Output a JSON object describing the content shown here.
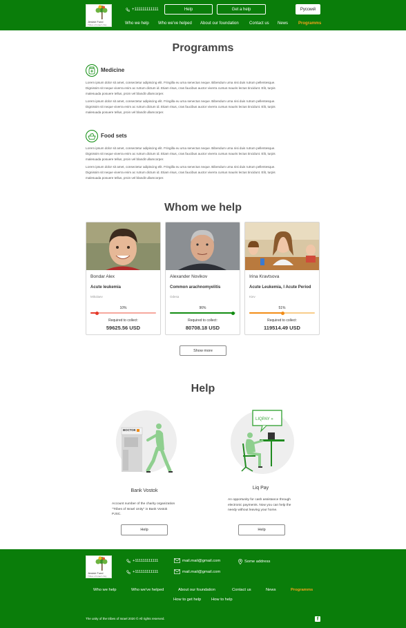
{
  "header": {
    "logo_text": "Jewish Fund",
    "logo_sub": "Tribes of Israel Unity",
    "phone": "+111111111111",
    "help_button": "Help",
    "get_help_button": "Get a help",
    "language_button": "Русский",
    "nav": [
      "Who we help",
      "Who we've helped",
      "About our foundation",
      "Contact us",
      "News",
      "Programms"
    ],
    "active_nav": "Programms"
  },
  "programs": {
    "title": "Programms",
    "items": [
      {
        "title": "Medicine",
        "icon": "medicine-bottle-icon",
        "paragraphs": [
          "Lorem ipsum dolor sit amet, consectetur adipiscing elit. Fringilla eu urna senectus neque. Bibendum urna nisi duis rutrum pellentesque. Dignissim sit neque viverra enim ac rutrum dictum id. Etiam risus, cras faucibus auctor viverra cursus mauris lectus tincidunt. Elit, turpis malesuada posuere tellus, proin vel blandit ullamcorper.",
          "Lorem ipsum dolor sit amet, consectetur adipiscing elit. Fringilla eu urna senectus neque. Bibendum urna nisi duis rutrum pellentesque. Dignissim sit neque viverra enim ac rutrum dictum id. Etiam risus, cras faucibus auctor viverra cursus mauris lectus tincidunt. Elit, turpis malesuada posuere tellus, proin vel blandit ullamcorper."
        ]
      },
      {
        "title": "Food sets",
        "icon": "food-basket-icon",
        "paragraphs": [
          "Lorem ipsum dolor sit amet, consectetur adipiscing elit. Fringilla eu urna senectus neque. Bibendum urna nisi duis rutrum pellentesque. Dignissim sit neque viverra enim ac rutrum dictum id. Etiam risus, cras faucibus auctor viverra cursus mauris lectus tincidunt. Elit, turpis malesuada posuere tellus, proin vel blandit ullamcorper.",
          "Lorem ipsum dolor sit amet, consectetur adipiscing elit. Fringilla eu urna senectus neque. Bibendum urna nisi duis rutrum pellentesque. Dignissim sit neque viverra enim ac rutrum dictum id. Etiam risus, cras faucibus auctor viverra cursus mauris lectus tincidunt. Elit, turpis malesuada posuere tellus, proin vel blandit ullamcorper."
        ]
      }
    ]
  },
  "whom": {
    "title": "Whom we help",
    "show_more": "Show more",
    "cards": [
      {
        "name": "Bondar Alex",
        "diagnosis": "Acute leukemia",
        "city": "Mikolaev",
        "percent_label": "10%",
        "progress": 0.1,
        "bar_color": "#e53a2a",
        "track_color": "#f6a79d",
        "required_label": "Required to collect:",
        "amount": "59625.56 USD"
      },
      {
        "name": "Alexander Novikov",
        "diagnosis": "Common arachnomyelitis",
        "city": "Odesa",
        "percent_label": "96%",
        "progress": 0.96,
        "bar_color": "#128c12",
        "track_color": "#9fd49f",
        "required_label": "Required to collect:",
        "amount": "80708.18 USD"
      },
      {
        "name": "Irina Kravtsova",
        "diagnosis": "Acute Leukemia, I Acute Period",
        "city": "Kiev",
        "percent_label": "51%",
        "progress": 0.51,
        "bar_color": "#f28c16",
        "track_color": "#f8cd8a",
        "required_label": "Required to collect:",
        "amount": "119514.49 USD"
      }
    ]
  },
  "help": {
    "title": "Help",
    "methods": [
      {
        "title": "Bank Vostok",
        "atm_label": "ВОСТОК",
        "text": "Account number of the charity organization \"Tribes of Israel Unity\" in Bank Vostok PJSC.",
        "button": "Help"
      },
      {
        "title": "Liq Pay",
        "bubble_label": "LIQPAY »",
        "text": "An opportunity for cash assistance through electronic payments. Now you can help the needy without leaving your home.",
        "button": "Help"
      }
    ]
  },
  "footer": {
    "phones": [
      "+111111111111",
      "+111111111111"
    ],
    "emails": [
      "mail.mail@gmail.com",
      "mail.mail@gmail.com"
    ],
    "address": "Some address",
    "nav": [
      "Who we help",
      "Who we've helped",
      "About our foundation",
      "Contact us",
      "News",
      "Programms"
    ],
    "nav2": [
      "How to get help",
      "How to help"
    ],
    "copyright": "The unity of the tribes of Israel 2020 © All rights reserved.",
    "facebook": "f"
  },
  "colors": {
    "brand_green": "#0a7d0a",
    "accent_orange": "#f7a21b"
  }
}
